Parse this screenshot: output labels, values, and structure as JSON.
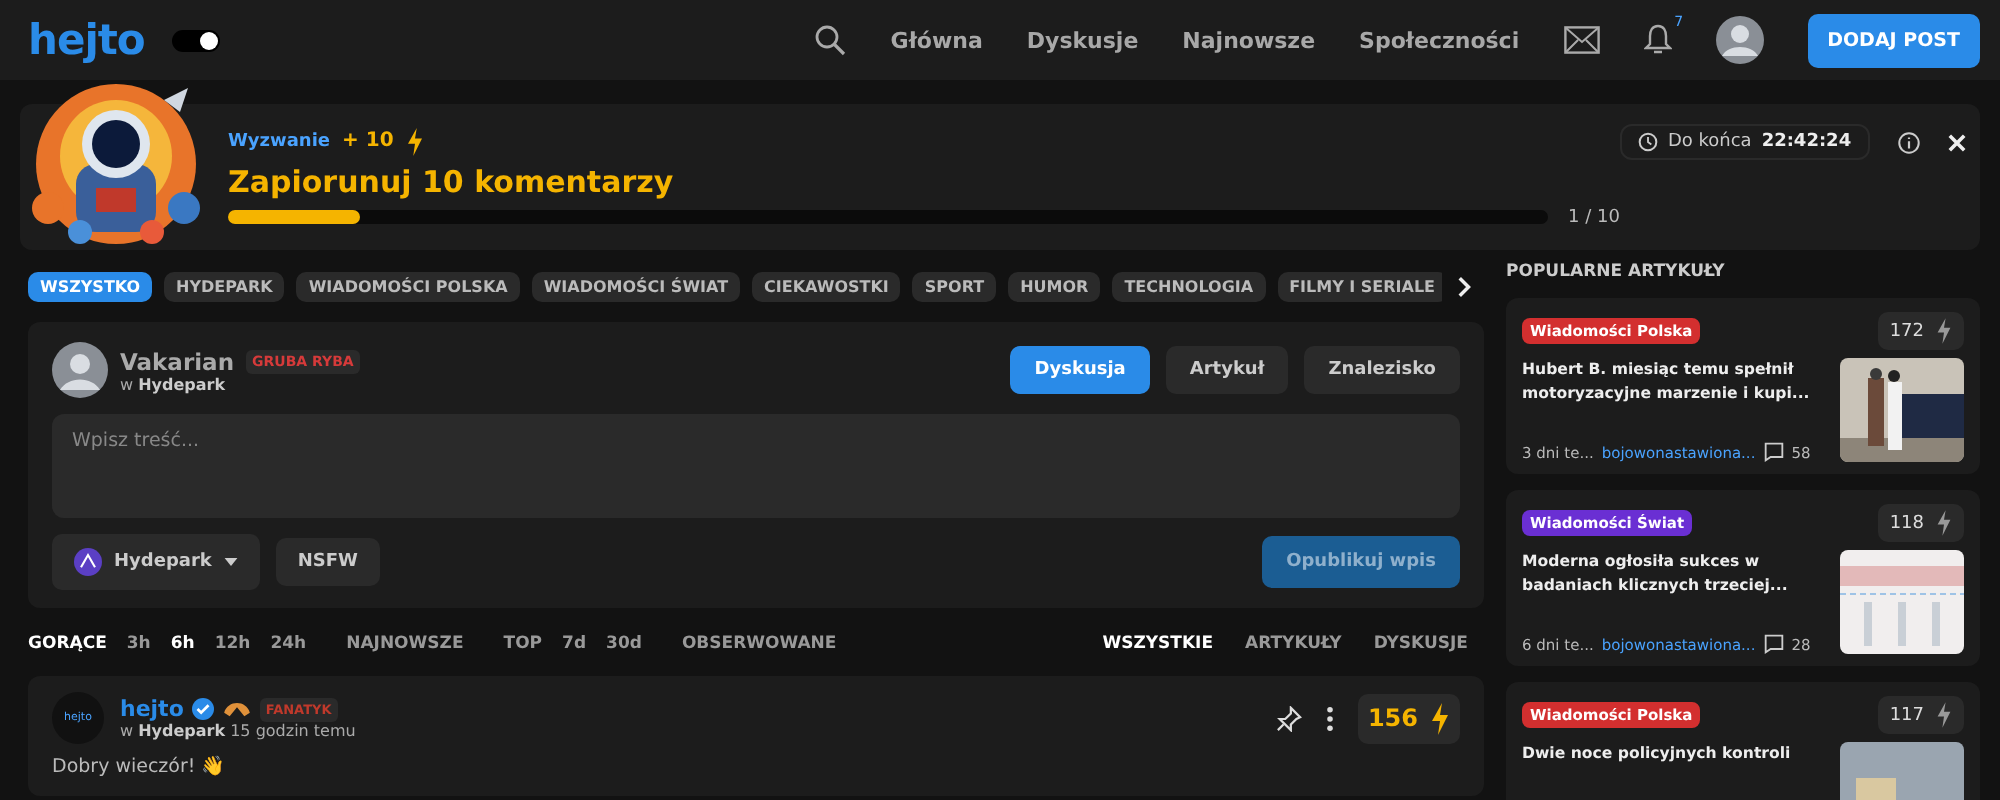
{
  "header": {
    "logo": "hejto",
    "dark_mode": true,
    "nav": [
      "Główna",
      "Dyskusje",
      "Najnowsze",
      "Społeczności"
    ],
    "notification_count": "7",
    "add_post": "DODAJ POST"
  },
  "challenge": {
    "label": "Wyzwanie",
    "reward": "+ 10",
    "title": "Zapiorunuj 10 komentarzy",
    "level": 0.1,
    "progress": "1 / 10",
    "countdown_label": "Do końca",
    "countdown": "22:42:24"
  },
  "categories": [
    {
      "label": "WSZYSTKO",
      "selected": true
    },
    {
      "label": "HYDEPARK",
      "selected": false
    },
    {
      "label": "WIADOMOŚCI POLSKA",
      "selected": false
    },
    {
      "label": "WIADOMOŚCI ŚWIAT",
      "selected": false
    },
    {
      "label": "CIEKAWOSTKI",
      "selected": false
    },
    {
      "label": "SPORT",
      "selected": false
    },
    {
      "label": "HUMOR",
      "selected": false
    },
    {
      "label": "TECHNOLOGIA",
      "selected": false
    },
    {
      "label": "FILMY I SERIALE",
      "selected": false
    }
  ],
  "composer": {
    "user": "Vakarian",
    "badge": "GRUBA RYBA",
    "community_prefix": "w",
    "community": "Hydepark",
    "types": [
      {
        "label": "Dyskusja",
        "selected": true
      },
      {
        "label": "Artykuł",
        "selected": false
      },
      {
        "label": "Znalezisko",
        "selected": false
      }
    ],
    "placeholder": "Wpisz treść...",
    "community_button": "Hydepark",
    "nsfw": "NSFW",
    "publish": "Opublikuj wpis"
  },
  "sort": {
    "left": [
      {
        "label": "GORĄCE",
        "selected": true
      },
      {
        "label": "3h",
        "selected": false
      },
      {
        "label": "6h",
        "selected": true
      },
      {
        "label": "12h",
        "selected": false
      },
      {
        "label": "24h",
        "selected": false
      },
      {
        "label": "NAJNOWSZE",
        "selected": false
      },
      {
        "label": "TOP",
        "selected": false
      },
      {
        "label": "7d",
        "selected": false
      },
      {
        "label": "30d",
        "selected": false
      },
      {
        "label": "OBSERWOWANE",
        "selected": false
      }
    ],
    "right": [
      {
        "label": "WSZYSTKIE",
        "selected": true
      },
      {
        "label": "ARTYKUŁY",
        "selected": false
      },
      {
        "label": "DYSKUSJE",
        "selected": false
      }
    ]
  },
  "post": {
    "avatar_text": "hejto",
    "author": "hejto",
    "verified": true,
    "badge": "FANATYK",
    "community_prefix": "w",
    "community": "Hydepark",
    "time": "15 godzin temu",
    "score": "156",
    "text": "Dobry wieczór! 👋"
  },
  "sidebar": {
    "title": "POPULARNE ARTYKUŁY",
    "articles": [
      {
        "category": "Wiadomości Polska",
        "color": "#d32f2f",
        "score": "172",
        "title": "Hubert B. miesiąc temu spełnił motoryzacyjne marzenie i kupi...",
        "time": "3 dni te...",
        "author": "bojowonastawiona...",
        "comments": "58"
      },
      {
        "category": "Wiadomości Świat",
        "color": "#6a2fd3",
        "score": "118",
        "title": "Moderna ogłosiła sukces w badaniach klicznych trzeciej...",
        "time": "6 dni te...",
        "author": "bojowonastawiona...",
        "comments": "28"
      },
      {
        "category": "Wiadomości Polska",
        "color": "#d32f2f",
        "score": "117",
        "title": "Dwie noce policyjnych kontroli"
      }
    ]
  }
}
